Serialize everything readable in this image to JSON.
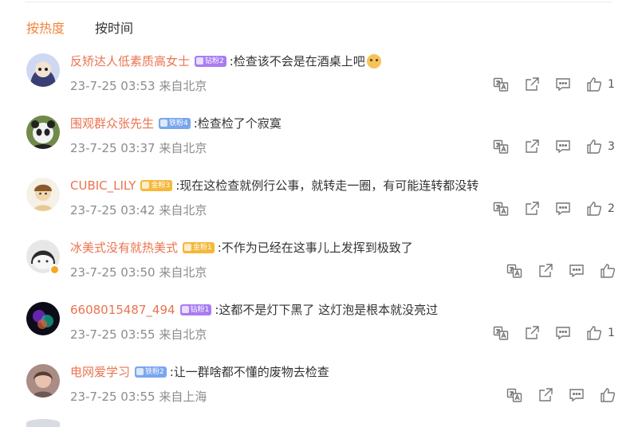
{
  "tabs": [
    {
      "label": "按热度",
      "active": true
    },
    {
      "label": "按时间",
      "active": false
    }
  ],
  "colors": {
    "accent": "#f0863b",
    "username": "#eb7350",
    "meta": "#8c8c8c"
  },
  "comments": [
    {
      "user": "反矫达人低素质高女士",
      "badge": "钻粉2",
      "badge_type": "diamond",
      "text": ":检查该不会是在酒桌上吧",
      "has_emoji": true,
      "time": "23-7-25 03:53",
      "location": "来自北京",
      "likes": "1"
    },
    {
      "user": "围观群众张先生",
      "badge": "铁粉4",
      "badge_type": "iron",
      "text": ":检查检了个寂寞",
      "has_emoji": false,
      "time": "23-7-25 03:37",
      "location": "来自北京",
      "likes": "3"
    },
    {
      "user": "CUBIC_LILY",
      "badge": "金粉3",
      "badge_type": "gold",
      "text": ":现在这检查就例行公事，就转走一圈，有可能连转都没转",
      "has_emoji": false,
      "time": "23-7-25 03:42",
      "location": "来自北京",
      "likes": "2"
    },
    {
      "user": "冰美式没有就热美式",
      "badge": "金粉1",
      "badge_type": "gold",
      "text": ":不作为已经在这事儿上发挥到极致了",
      "has_emoji": false,
      "time": "23-7-25 03:50",
      "location": "来自北京",
      "likes": ""
    },
    {
      "user": "6608015487_494",
      "badge": "钻粉1",
      "badge_type": "diamond",
      "text": ":这都不是灯下黑了 这灯泡是根本就没亮过",
      "has_emoji": false,
      "time": "23-7-25 03:55",
      "location": "来自北京",
      "likes": "1"
    },
    {
      "user": "电网爱学习",
      "badge": "铁粉2",
      "badge_type": "iron",
      "text": ":让一群啥都不懂的废物去检查",
      "has_emoji": false,
      "time": "23-7-25 03:55",
      "location": "来自上海",
      "likes": ""
    }
  ],
  "icons": {
    "translate": "translate-icon",
    "share": "share-icon",
    "reply": "comment-icon",
    "like": "thumbs-up-icon"
  }
}
